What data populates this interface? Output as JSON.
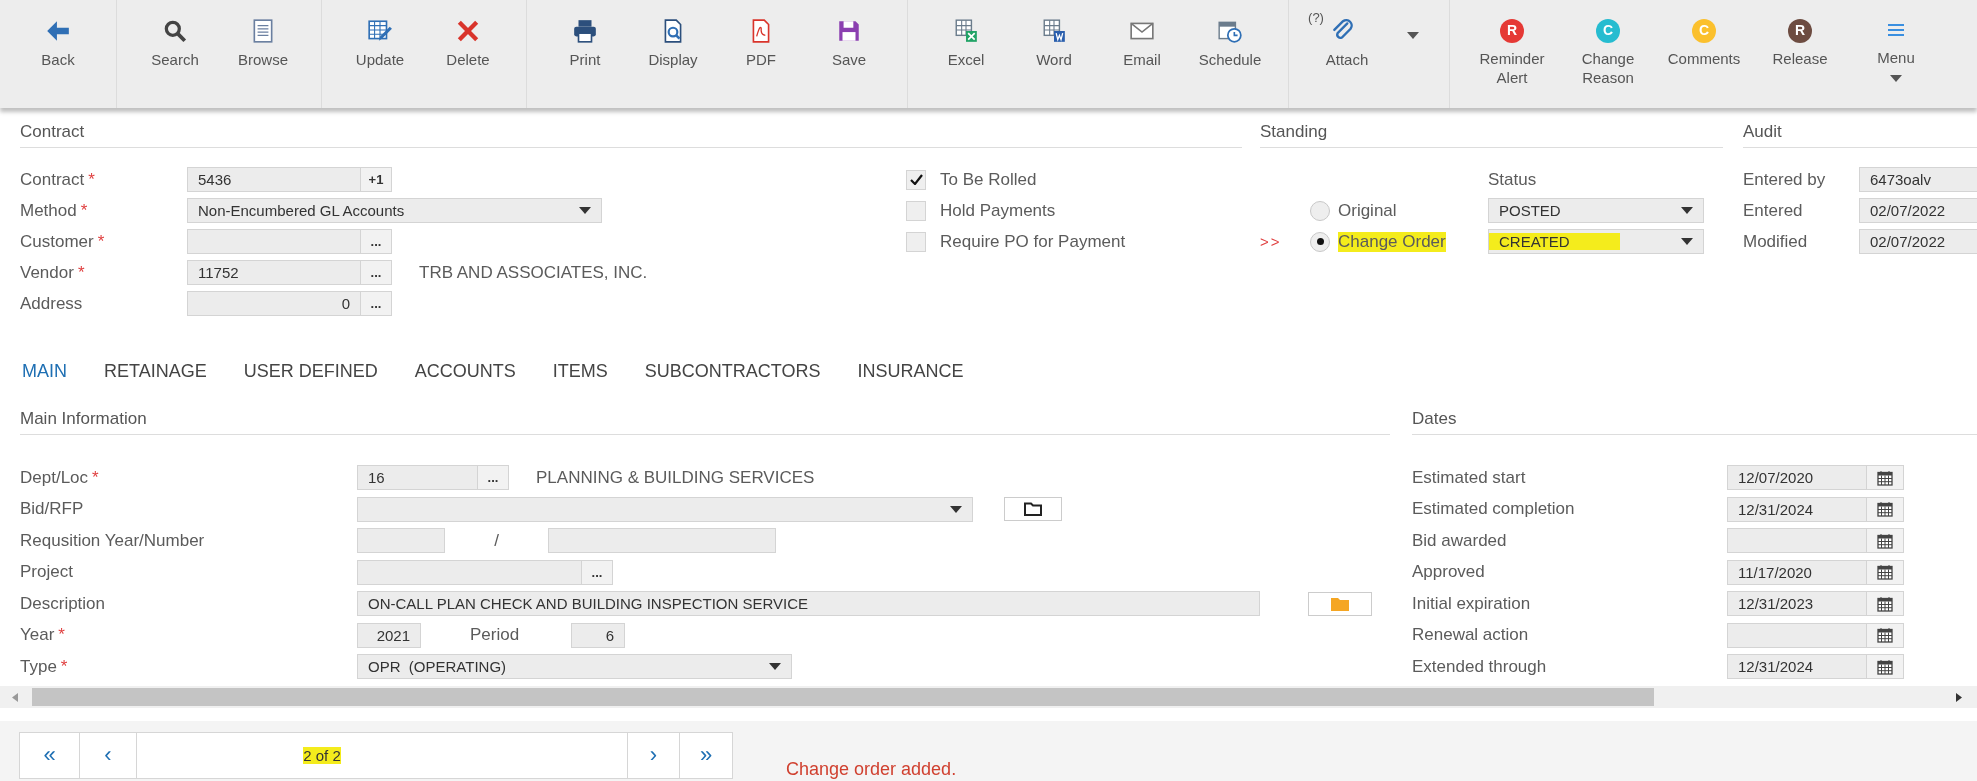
{
  "toolbar": [
    [
      {
        "label": "Back",
        "kind": "icon"
      }
    ],
    [
      {
        "label": "Search",
        "kind": "icon"
      },
      {
        "label": "Browse",
        "kind": "icon"
      }
    ],
    [
      {
        "label": "Update",
        "kind": "icon"
      },
      {
        "label": "Delete",
        "kind": "icon"
      }
    ],
    [
      {
        "label": "Print",
        "kind": "icon"
      },
      {
        "label": "Display",
        "kind": "icon"
      },
      {
        "label": "PDF",
        "kind": "icon"
      },
      {
        "label": "Save",
        "kind": "icon"
      }
    ],
    [
      {
        "label": "Excel",
        "kind": "icon"
      },
      {
        "label": "Word",
        "kind": "icon"
      },
      {
        "label": "Email",
        "kind": "icon"
      },
      {
        "label": "Schedule",
        "kind": "icon"
      }
    ],
    [
      {
        "label": "Attach",
        "kind": "icon",
        "hint": "(?)",
        "dropdown": true
      }
    ],
    [
      {
        "label": "Reminder Alert",
        "kind": "badge",
        "badge": "R",
        "color": "#e53935"
      },
      {
        "label": "Change Reason",
        "kind": "badge",
        "badge": "C",
        "color": "#26bcd0"
      },
      {
        "label": "Comments",
        "kind": "badge",
        "badge": "C",
        "color": "#fbc02d"
      },
      {
        "label": "Release",
        "kind": "badge",
        "badge": "R",
        "color": "#6d4c41"
      },
      {
        "label": "Menu",
        "kind": "menu"
      }
    ]
  ],
  "contract": {
    "title": "Contract",
    "fields": [
      {
        "label": "Contract",
        "required_mark": "*",
        "kind": "text",
        "value": "5436",
        "button": "+1"
      },
      {
        "label": "Method",
        "required_mark": "*",
        "kind": "select",
        "value": "Non-Encumbered GL Accounts"
      },
      {
        "label": "Customer",
        "required_mark": "*",
        "kind": "text",
        "button": "..."
      },
      {
        "label": "Vendor",
        "required_mark": "*",
        "kind": "text",
        "value": "11752",
        "button": "...",
        "description": "TRB AND ASSOCIATES, INC."
      },
      {
        "label": "Address",
        "kind": "number",
        "value": "0",
        "button": "..."
      }
    ],
    "options": [
      {
        "label": "To Be Rolled",
        "checked": true
      },
      {
        "label": "Hold Payments",
        "checked": false
      },
      {
        "label": "Require PO for Payment",
        "checked": false
      }
    ]
  },
  "standing": {
    "title": "Standing",
    "status_label": "Status",
    "pointer": ">>",
    "rows": [
      {
        "label": "Original",
        "selected": false,
        "status": "POSTED",
        "highlighted": false
      },
      {
        "label": "Change Order",
        "selected": true,
        "status": "CREATED",
        "highlighted": true
      }
    ]
  },
  "audit": {
    "title": "Audit",
    "fields": [
      {
        "label": "Entered by",
        "value": "6473oalv"
      },
      {
        "label": "Entered",
        "value": "02/07/2022"
      },
      {
        "label": "Modified",
        "value": "02/07/2022"
      }
    ]
  },
  "tabs": [
    {
      "label": "MAIN",
      "selected": true
    },
    {
      "label": "RETAINAGE",
      "selected": false
    },
    {
      "label": "USER DEFINED",
      "selected": false
    },
    {
      "label": "ACCOUNTS",
      "selected": false
    },
    {
      "label": "ITEMS",
      "selected": false
    },
    {
      "label": "SUBCONTRACTORS",
      "selected": false
    },
    {
      "label": "INSURANCE",
      "selected": false
    }
  ],
  "main": {
    "title": "Main Information",
    "fields": [
      {
        "label": "Dept/Loc",
        "required_mark": "*",
        "kind": "text",
        "value": "16",
        "button": "...",
        "description": "PLANNING & BUILDING SERVICES"
      },
      {
        "label": "Bid/RFP",
        "kind": "select"
      },
      {
        "label": "Requsition Year/Number",
        "kind": "split",
        "separator": "/"
      },
      {
        "label": "Project",
        "kind": "text",
        "button": "..."
      },
      {
        "label": "Description",
        "kind": "text",
        "value": "ON-CALL PLAN CHECK AND BUILDING INSPECTION SERVICE"
      },
      {
        "label": "Year",
        "required_mark": "*",
        "kind": "pair",
        "value": "2021",
        "second_label": "Period",
        "second_value": "6"
      },
      {
        "label": "Type",
        "required_mark": "*",
        "kind": "select",
        "value": "OPR  (OPERATING)"
      }
    ]
  },
  "dates": {
    "title": "Dates",
    "fields": [
      {
        "label": "Estimated start",
        "value": "12/07/2020"
      },
      {
        "label": "Estimated completion",
        "value": "12/31/2024"
      },
      {
        "label": "Bid awarded"
      },
      {
        "label": "Approved",
        "value": "11/17/2020"
      },
      {
        "label": "Initial expiration",
        "value": "12/31/2023"
      },
      {
        "label": "Renewal action"
      },
      {
        "label": "Extended through",
        "value": "12/31/2024"
      }
    ]
  },
  "pager": {
    "first": "«",
    "prev": "‹",
    "position": "2 of 2",
    "position_highlighted": true,
    "next": "›",
    "last": "»"
  },
  "message": "Change order added."
}
